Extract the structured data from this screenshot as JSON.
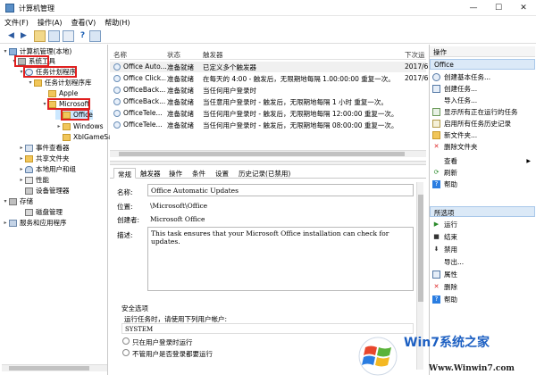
{
  "window": {
    "title": "计算机管理",
    "controls": [
      "—",
      "☐",
      "✕"
    ]
  },
  "menu": [
    "文件(F)",
    "操作(A)",
    "查看(V)",
    "帮助(H)"
  ],
  "tree": {
    "root": "计算机管理(本地)",
    "system_tools": "系统工具",
    "task_scheduler": "任务计划程序",
    "task_library": "任务计划程序库",
    "apple": "Apple",
    "microsoft": "Microsoft",
    "office": "Office",
    "windows": "Windows",
    "xbl": "XblGameSa",
    "event_viewer": "事件查看器",
    "shared_folders": "共享文件夹",
    "local_users": "本地用户和组",
    "performance": "性能",
    "device_manager": "设备管理器",
    "storage": "存储",
    "disk_mgmt": "磁盘管理",
    "services": "服务和应用程序"
  },
  "list": {
    "columns": [
      "名称",
      "状态",
      "触发器",
      "下次运"
    ],
    "rows": [
      {
        "name": "Office Auto...",
        "status": "准备就绪",
        "trigger": "已定义多个触发器",
        "next": "2017/6"
      },
      {
        "name": "Office Click...",
        "status": "准备就绪",
        "trigger": "在每天的 4:00 - 触发后，无限期地每隔 1.00:00:00 重复一次。",
        "next": "2017/6"
      },
      {
        "name": "OfficeBack...",
        "status": "准备就绪",
        "trigger": "当任何用户登录时",
        "next": ""
      },
      {
        "name": "OfficeBack...",
        "status": "准备就绪",
        "trigger": "当任意用户登录时 - 触发后，无限期地每隔 1 小时 重复一次。",
        "next": ""
      },
      {
        "name": "OfficeTele...",
        "status": "准备就绪",
        "trigger": "当任何用户登录时 - 触发后，无限期地每隔 12:00:00 重复一次。",
        "next": ""
      },
      {
        "name": "OfficeTele...",
        "status": "准备就绪",
        "trigger": "当任何用户登录时 - 触发后，无限期地每隔 08:00:00 重复一次。",
        "next": ""
      }
    ]
  },
  "tabs": [
    "常规",
    "触发器",
    "操作",
    "条件",
    "设置",
    "历史记录(已禁用)"
  ],
  "details": {
    "name_label": "名称:",
    "name_value": "Office Automatic Updates",
    "location_label": "位置:",
    "location_value": "\\Microsoft\\Office",
    "author_label": "创建者:",
    "author_value": "Microsoft Office",
    "desc_label": "描述:",
    "desc_value": "This task ensures that your Microsoft Office installation can check for updates.",
    "security_title": "安全选项",
    "run_as_label": "运行任务时，请使用下列用户帐户:",
    "run_as_value": "SYSTEM",
    "radio1": "只在用户登录时运行",
    "radio2": "不管用户是否登录都要运行"
  },
  "actions": {
    "header": "操作",
    "office_header": "Office",
    "items": [
      "创建基本任务...",
      "创建任务...",
      "导入任务...",
      "显示所有正在运行的任务",
      "启用所有任务历史记录",
      "新文件夹...",
      "删除文件夹",
      "查看",
      "刷新",
      "帮助"
    ],
    "selected_header": "所选项",
    "selected_items": [
      "运行",
      "结束",
      "禁用",
      "导出...",
      "属性",
      "删除",
      "帮助"
    ]
  },
  "watermark": {
    "brand": "Win7系统之家",
    "url": "Www.Winwin7.com"
  }
}
